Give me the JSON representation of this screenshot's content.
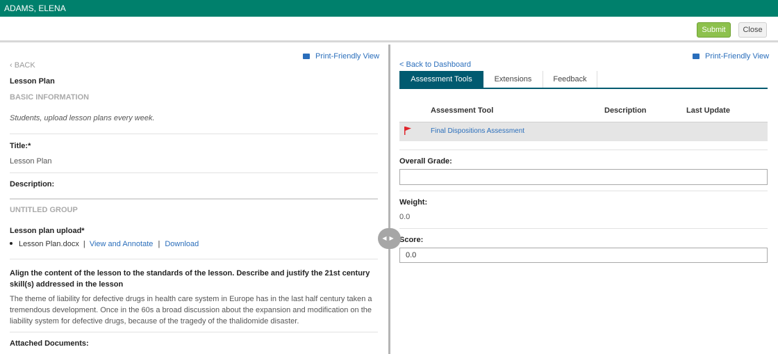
{
  "header": {
    "user_name": "ADAMS, ELENA"
  },
  "actions": {
    "submit_label": "Submit",
    "close_label": "Close"
  },
  "left": {
    "print_label": "Print-Friendly View",
    "back_label": "BACK",
    "doc_title": "Lesson Plan",
    "basic_info_heading": "BASIC INFORMATION",
    "instructions": "Students, upload lesson plans every week.",
    "title_label": "Title:*",
    "title_value": "Lesson Plan",
    "description_label": "Description:",
    "group_heading": "UNTITLED GROUP",
    "upload_label": "Lesson plan upload*",
    "file_name": "Lesson Plan.docx",
    "view_annotate_label": "View and Annotate",
    "download_label": "Download",
    "prompt": "Align the content of the lesson to the standards of the lesson. Describe and justify the 21st century skill(s) addressed in the lesson",
    "response_line1": "The theme of liability for defective drugs in health care system in Europe has in the last half century taken a",
    "response_line2": "tremendous development. Once in the 60s a broad discussion about the expansion and modification on the",
    "response_line3": "liability system for defective drugs, because of the tragedy of the thalidomide disaster.",
    "attached_label": "Attached Documents:"
  },
  "right": {
    "print_label": "Print-Friendly View",
    "back_dashboard_label": "< Back to Dashboard",
    "tabs": [
      {
        "label": "Assessment Tools"
      },
      {
        "label": "Extensions"
      },
      {
        "label": "Feedback"
      }
    ],
    "columns": {
      "tool": "Assessment Tool",
      "description": "Description",
      "last_update": "Last Update"
    },
    "rows": [
      {
        "tool": "Final Dispositions Assessment",
        "description": "",
        "last_update": ""
      }
    ],
    "overall_grade_label": "Overall Grade:",
    "overall_grade_value": "",
    "weight_label": "Weight:",
    "weight_value": "0.0",
    "score_label": "Score:",
    "score_value": "0.0"
  },
  "icons": {
    "print": "printer-icon",
    "back": "chevron-left-icon",
    "flag": "flag-icon",
    "splitter": "resize-handle-icon"
  },
  "colors": {
    "header": "#00806c",
    "submit": "#8dc14d",
    "tab_active": "#005a70",
    "link": "#2a6ebb",
    "flag": "#e0252b"
  }
}
